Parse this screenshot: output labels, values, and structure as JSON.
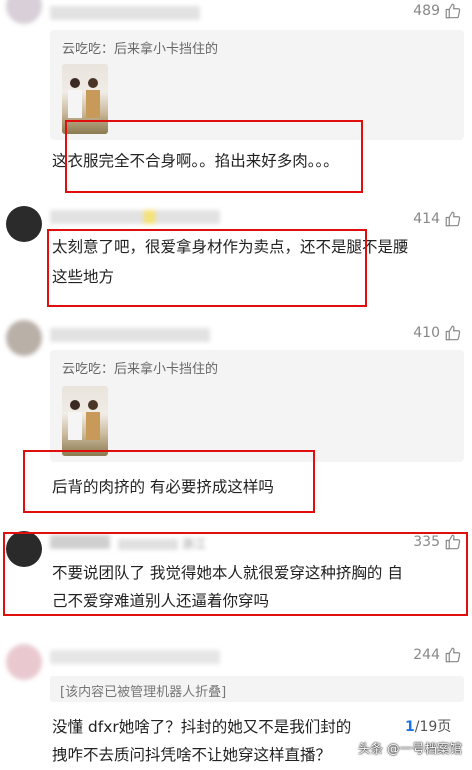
{
  "comments": [
    {
      "likes": "489",
      "quote_author": "云吃吃",
      "quote_text": "云吃吃：后来拿小卡挡住的",
      "text": "这衣服完全不合身啊。。掐出来好多肉。。。"
    },
    {
      "likes": "414",
      "text_lines": [
        "太刻意了吧，很爱拿身材作为卖点，还不是腿不是腰",
        "这些地方"
      ]
    },
    {
      "likes": "410",
      "quote_text": "云吃吃：后来拿小卡挡住的",
      "text": "后背的肉挤的 有必要挤成这样吗"
    },
    {
      "likes": "335",
      "meta_blurred": "浙江",
      "text_lines": [
        "不要说团队了 我觉得她本人就很爱穿这种挤胸的 自",
        "己不爱穿难道别人还逼着你穿吗"
      ]
    },
    {
      "likes": "244",
      "folded_notice": "[该内容已被管理机器人折叠]",
      "text_lines": [
        "没懂 dfxr她啥了？抖封的她又不是我们封的",
        "拽咋不去质问抖凭啥不让她穿这样直播？"
      ]
    }
  ],
  "page_indicator": {
    "current": "1",
    "total": "/19页"
  },
  "watermark": "头条 @一号档案馆",
  "colors": {
    "highlight_box": "#e10e0e",
    "quote_bg": "#f4f4f4",
    "likes_text": "#888888"
  },
  "icons": {
    "like": "thumbs-up-icon"
  }
}
